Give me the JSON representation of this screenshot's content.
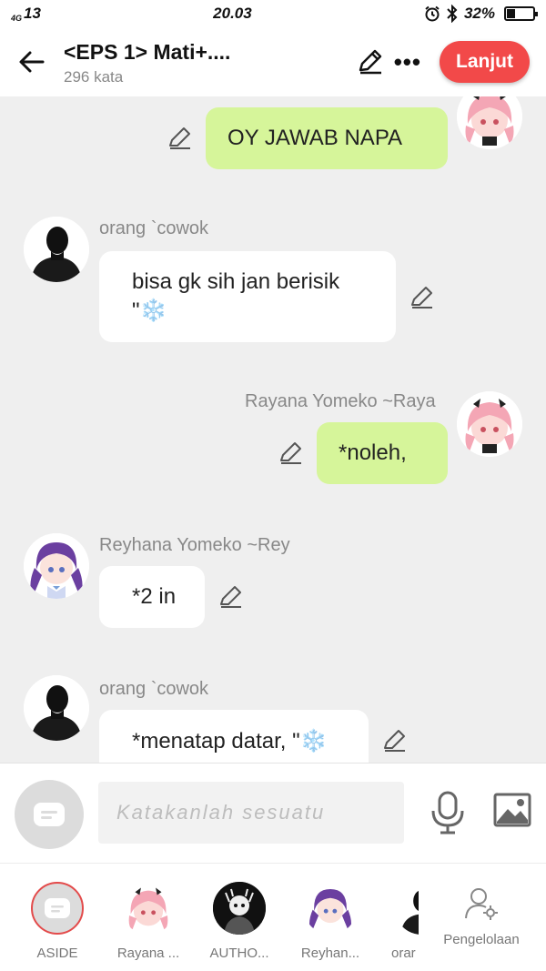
{
  "status_bar": {
    "signal": "4G",
    "signal_bars": "13",
    "time": "20.03",
    "battery_pct": "32%",
    "battery_level": 0.32
  },
  "header": {
    "title": "<EPS 1> Mati+....",
    "word_count": "296 kata",
    "continue_label": "Lanjut"
  },
  "messages": [
    {
      "side": "right",
      "name": "",
      "text": "OY JAWAB NAPA",
      "avatar": "pink-hair-girl"
    },
    {
      "side": "left",
      "name": "orang `cowok",
      "text_line1": "bisa gk sih jan berisik",
      "text_line2": "\"❄️",
      "avatar": "silhouette"
    },
    {
      "side": "right",
      "name": "Rayana Yomeko ~Raya",
      "text": "*noleh,",
      "avatar": "pink-hair-girl"
    },
    {
      "side": "left",
      "name": "Reyhana Yomeko ~Rey",
      "text": "*2 in",
      "avatar": "purple-hair-girl"
    },
    {
      "side": "left",
      "name": "orang `cowok",
      "text": "*menatap datar, \"❄️",
      "avatar": "silhouette"
    }
  ],
  "input": {
    "placeholder": "Katakanlah sesuatu"
  },
  "bottom_bar": {
    "items": [
      {
        "label": "ASIDE"
      },
      {
        "label": "Rayana ..."
      },
      {
        "label": "AUTHO..."
      },
      {
        "label": "Reyhan..."
      },
      {
        "label": "orar"
      },
      {
        "label": "Pengelolaan"
      }
    ]
  }
}
